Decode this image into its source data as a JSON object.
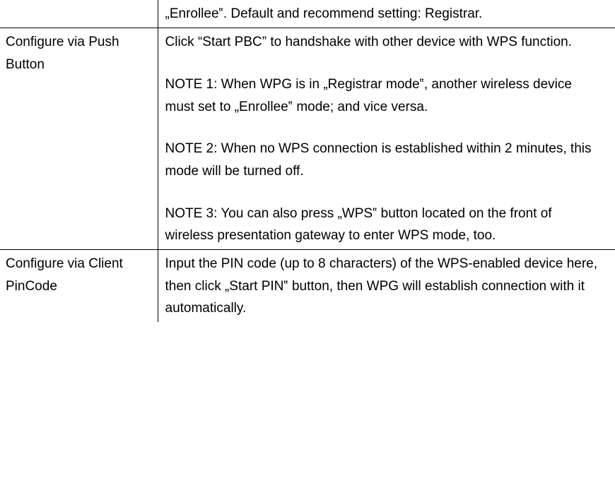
{
  "rows": [
    {
      "left": "",
      "right": {
        "paras": [
          "„Enrollee‟. Default and recommend setting: Registrar."
        ]
      }
    },
    {
      "left": "Configure via Push Button",
      "right": {
        "intro": "Click “Start PBC” to handshake with other device with WPS function.",
        "notes": [
          "NOTE 1: When WPG is in „Registrar mode‟, another wireless device must set to „Enrollee‟ mode; and vice versa.",
          "NOTE 2: When no WPS connection is established within 2 minutes, this mode will be turned off.",
          "NOTE 3: You can also press „WPS‟ button located on the front of wireless presentation gateway to enter WPS mode, too."
        ]
      }
    },
    {
      "left": "Configure via Client PinCode",
      "right": {
        "paras": [
          "Input the PIN code (up to 8 characters) of the WPS-enabled device here, then click „Start PIN‟ button, then WPG will establish connection with it automatically."
        ]
      }
    }
  ]
}
